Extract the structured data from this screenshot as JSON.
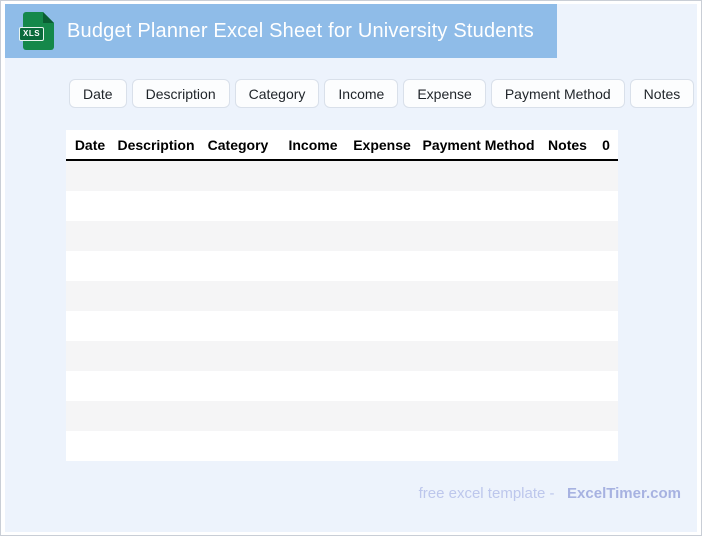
{
  "header": {
    "title": "Budget Planner Excel Sheet for University Students",
    "file_icon": {
      "label": "XLS"
    }
  },
  "filter_chips": [
    "Date",
    "Description",
    "Category",
    "Income",
    "Expense",
    "Payment Method",
    "Notes"
  ],
  "table": {
    "columns": [
      "Date",
      "Description",
      "Category",
      "Income",
      "Expense",
      "Payment Method",
      "Notes",
      "0"
    ],
    "rows": [
      [
        "",
        "",
        "",
        "",
        "",
        "",
        "",
        ""
      ],
      [
        "",
        "",
        "",
        "",
        "",
        "",
        "",
        ""
      ],
      [
        "",
        "",
        "",
        "",
        "",
        "",
        "",
        ""
      ],
      [
        "",
        "",
        "",
        "",
        "",
        "",
        "",
        ""
      ],
      [
        "",
        "",
        "",
        "",
        "",
        "",
        "",
        ""
      ],
      [
        "",
        "",
        "",
        "",
        "",
        "",
        "",
        ""
      ],
      [
        "",
        "",
        "",
        "",
        "",
        "",
        "",
        ""
      ],
      [
        "",
        "",
        "",
        "",
        "",
        "",
        "",
        ""
      ],
      [
        "",
        "",
        "",
        "",
        "",
        "",
        "",
        ""
      ],
      [
        "",
        "",
        "",
        "",
        "",
        "",
        "",
        ""
      ]
    ]
  },
  "footer": {
    "text": "free excel template -",
    "brand": "ExcelTimer.com"
  },
  "colors": {
    "header_band": "#8fbce8",
    "page_background": "#edf3fc",
    "file_icon_body": "#15884a",
    "file_icon_fold": "#0b5e33",
    "xls_badge": "#0a6b3b",
    "row_stripe": "#f5f5f6",
    "header_rule": "#000000",
    "footer_text": "#bdc7ec",
    "footer_brand": "#a7b2e1"
  }
}
